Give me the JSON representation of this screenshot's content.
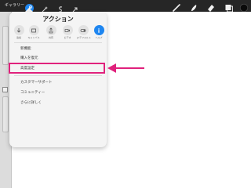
{
  "toolbar": {
    "gallery_label": "ギャラリー"
  },
  "popover": {
    "title": "アクション",
    "tabs": [
      {
        "label": "追加",
        "icon": "add-icon"
      },
      {
        "label": "キャンバス",
        "icon": "canvas-icon"
      },
      {
        "label": "共有",
        "icon": "share-icon"
      },
      {
        "label": "ビデオ",
        "icon": "video-icon"
      },
      {
        "label": "ｐデフォルト",
        "icon": "preferences-icon"
      },
      {
        "label": "ヘルプ",
        "icon": "info-icon"
      }
    ],
    "items": [
      "新機能",
      "購入を復元",
      "高度設定",
      "カスタマーサポート",
      "コミュニティー",
      "さらに詳しく"
    ],
    "active_tab_index": 5
  },
  "colors": {
    "toolbar": "#262626",
    "accent": "#1e86f0",
    "highlight": "#e0217c"
  }
}
